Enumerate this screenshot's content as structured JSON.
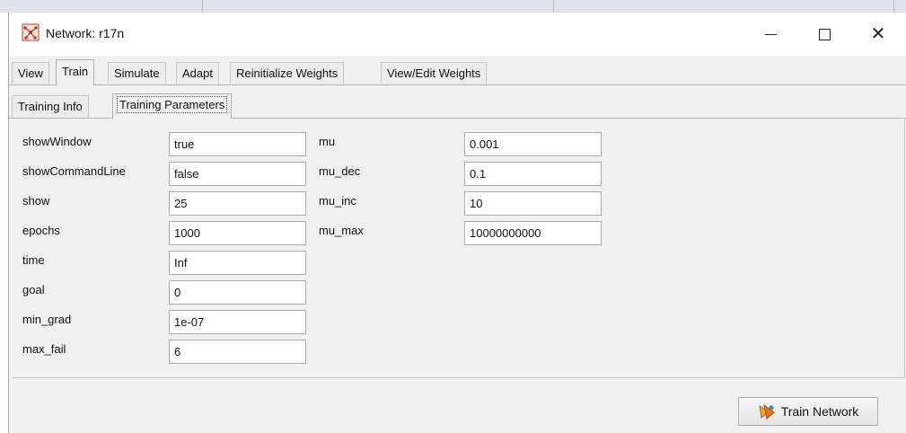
{
  "window": {
    "title": "Network: r17n"
  },
  "main_tabs": [
    {
      "label": "View",
      "active": false
    },
    {
      "label": "Train",
      "active": true
    },
    {
      "label": "Simulate",
      "active": false
    },
    {
      "label": "Adapt",
      "active": false
    },
    {
      "label": "Reinitialize Weights",
      "active": false
    },
    {
      "label": "View/Edit Weights",
      "active": false
    }
  ],
  "sub_tabs": [
    {
      "label": "Training Info",
      "active": false
    },
    {
      "label": "Training Parameters",
      "active": true
    }
  ],
  "params_left": [
    {
      "name": "showWindow",
      "value": "true"
    },
    {
      "name": "showCommandLine",
      "value": "false"
    },
    {
      "name": "show",
      "value": "25"
    },
    {
      "name": "epochs",
      "value": "1000"
    },
    {
      "name": "time",
      "value": "Inf"
    },
    {
      "name": "goal",
      "value": "0"
    },
    {
      "name": "min_grad",
      "value": "1e-07"
    },
    {
      "name": "max_fail",
      "value": "6"
    }
  ],
  "params_right": [
    {
      "name": "mu",
      "value": "0.001"
    },
    {
      "name": "mu_dec",
      "value": "0.1"
    },
    {
      "name": "mu_inc",
      "value": "10"
    },
    {
      "name": "mu_max",
      "value": "10000000000"
    }
  ],
  "actions": {
    "train_network_label": "Train Network"
  },
  "icons": {
    "app": "neural-network-icon",
    "minimize": "minimize-icon",
    "maximize": "maximize-icon",
    "close": "close-icon",
    "train": "train-icon"
  },
  "colors": {
    "window_bg": "#f0f0f0",
    "accent": "#e07818"
  }
}
